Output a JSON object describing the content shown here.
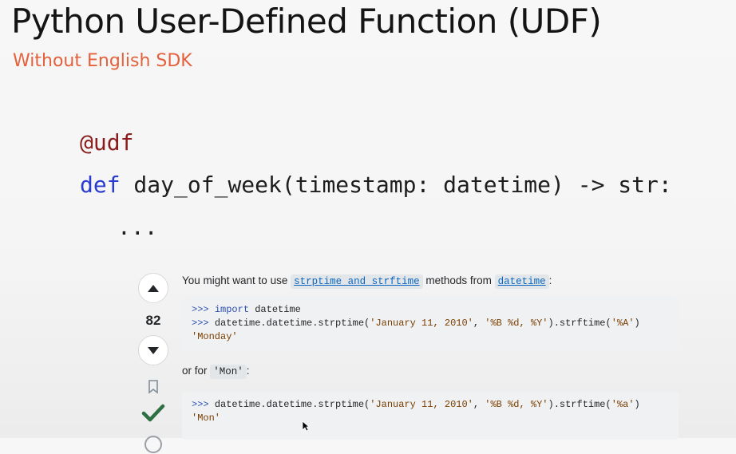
{
  "slide": {
    "title": "Python User-Defined Function (UDF)",
    "subtitle": "Without English SDK",
    "code": {
      "decorator": "@udf",
      "def_keyword": "def",
      "signature": " day_of_week(timestamp: datetime) -> str:",
      "ellipsis": "..."
    }
  },
  "answer": {
    "vote_count": "82",
    "intro_text_before": "You might want to use ",
    "intro_link_1": "strptime and strftime",
    "intro_text_middle": " methods from ",
    "intro_link_2": "datetime",
    "intro_text_after": ":",
    "code_block_1": {
      "line1_prompt": ">>> ",
      "line1_kw": "import",
      "line1_rest": " datetime",
      "line2_prompt": ">>> ",
      "line2_pre": "datetime.datetime.strptime(",
      "line2_arg1": "'January 11, 2010'",
      "line2_sep": ", ",
      "line2_arg2": "'%B %d, %Y'",
      "line2_mid": ").strftime(",
      "line2_arg3": "'%A'",
      "line2_end": ")",
      "line3_output": "'Monday'"
    },
    "or_text": "or for ",
    "or_code": "'Mon'",
    "or_after": ":",
    "code_block_2": {
      "line1_prompt": ">>> ",
      "line1_pre": "datetime.datetime.strptime(",
      "line1_arg1": "'January 11, 2010'",
      "line1_sep": ", ",
      "line1_arg2": "'%B %d, %Y'",
      "line1_mid": ").strftime(",
      "line1_arg3": "'%a'",
      "line1_end": ")",
      "line2_output": "'Mon'"
    }
  },
  "icons": {
    "upvote": "upvote-arrow-icon",
    "downvote": "downvote-arrow-icon",
    "bookmark": "bookmark-icon",
    "accepted": "accepted-checkmark-icon",
    "history": "history-icon",
    "cursor": "mouse-cursor-icon"
  },
  "colors": {
    "subtitle": "#e4613c",
    "decorator": "#8a1d1d",
    "keyword": "#2a3ccf",
    "link": "#0a66c2",
    "accepted": "#2f6f44"
  }
}
